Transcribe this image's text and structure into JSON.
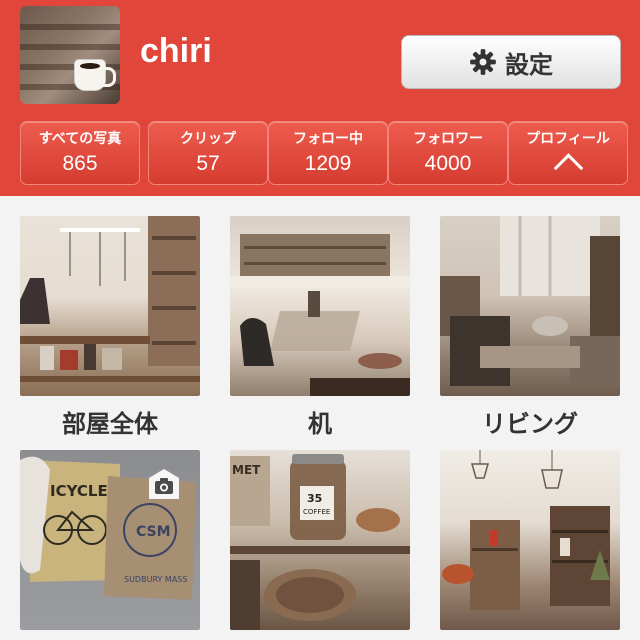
{
  "profile": {
    "username": "chiri",
    "settings_label": "設定",
    "settings_icon": "gear-icon"
  },
  "stats": [
    {
      "label": "すべての写真",
      "value": "865"
    },
    {
      "label": "クリップ",
      "value": "57"
    },
    {
      "label": "フォロー中",
      "value": "1209"
    },
    {
      "label": "フォロワー",
      "value": "4000"
    },
    {
      "label": "プロフィール",
      "icon": "chevron-up-icon"
    }
  ],
  "albums": [
    {
      "caption": "部屋全体"
    },
    {
      "caption": "机"
    },
    {
      "caption": "リビング"
    },
    {
      "caption": "",
      "badge": "camera-icon"
    },
    {
      "caption": ""
    },
    {
      "caption": ""
    }
  ],
  "colors": {
    "header": "#e0473a",
    "stat_button": "#e34b3e",
    "settings_button": "#f1f1f1"
  }
}
